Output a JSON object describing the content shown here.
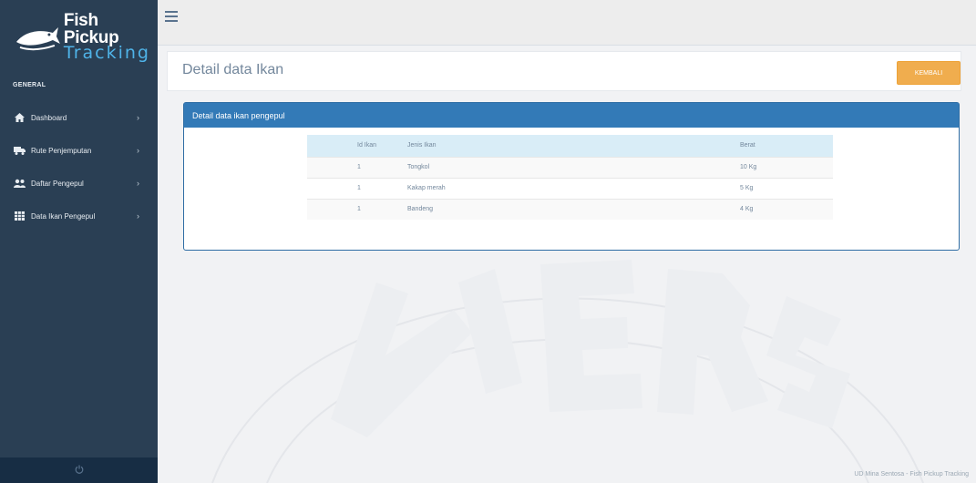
{
  "app": {
    "brand_line1": "Fish Pickup",
    "brand_line2": "Tracking",
    "section_label": "GENERAL"
  },
  "sidebar": {
    "items": [
      {
        "label": "Dashboard",
        "icon": "home-icon"
      },
      {
        "label": "Rute Penjemputan",
        "icon": "truck-icon"
      },
      {
        "label": "Daftar Pengepul",
        "icon": "users-icon"
      },
      {
        "label": "Data Ikan Pengepul",
        "icon": "table-icon"
      }
    ]
  },
  "page": {
    "title": "Detail data Ikan",
    "back_label": "KEMBALI"
  },
  "panel": {
    "heading": "Detail data ikan pengepul"
  },
  "table": {
    "headers": [
      "Id Ikan",
      "Jenis Ikan",
      "Berat"
    ],
    "rows": [
      {
        "id": "1",
        "name": "Tongkol",
        "weight": "10 Kg"
      },
      {
        "id": "1",
        "name": "Kakap merah",
        "weight": "5 Kg"
      },
      {
        "id": "1",
        "name": "Bandeng",
        "weight": "4 Kg"
      }
    ]
  },
  "footer": {
    "text": "UD Mina Sentosa - Fish Pickup Tracking"
  },
  "colors": {
    "sidebar": "#2a3f54",
    "panel_primary": "#337ab7",
    "button_warning": "#f0ad4e",
    "table_header": "#d9edf7"
  }
}
